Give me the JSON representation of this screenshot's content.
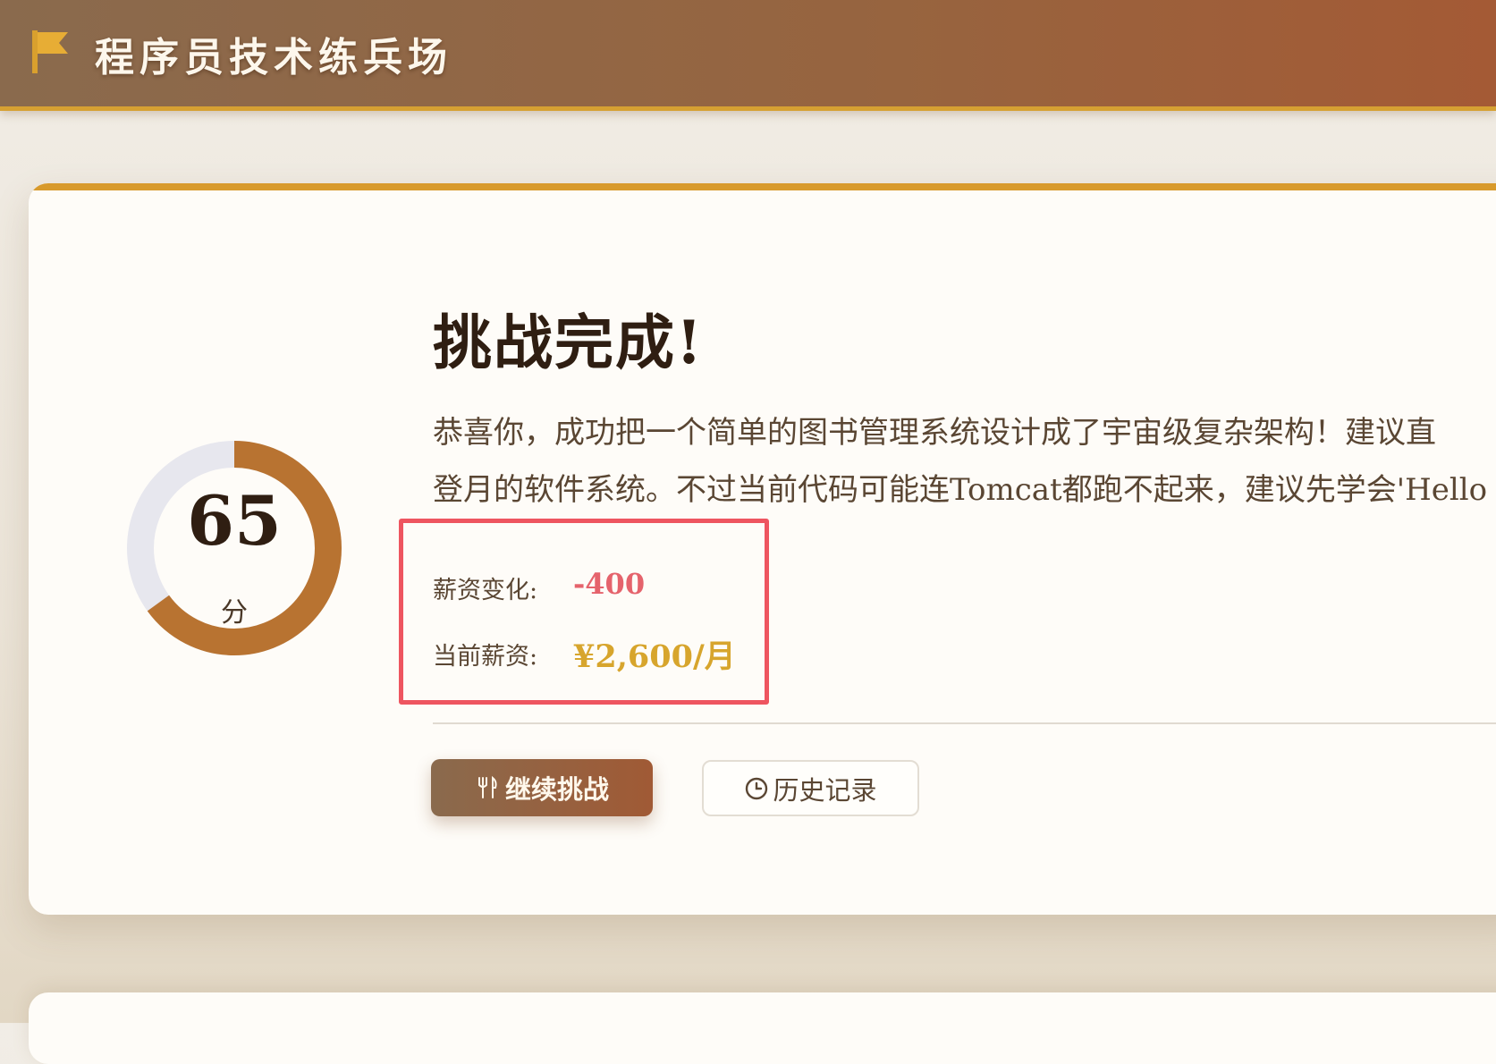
{
  "header": {
    "title": "程序员技术练兵场",
    "icon": "flag-icon"
  },
  "result": {
    "score": "65",
    "score_unit": "分",
    "score_percent": 65,
    "title": "挑战完成!",
    "description_line1": "恭喜你，成功把一个简单的图书管理系统设计成了宇宙级复杂架构！建议直",
    "description_line2": "登月的软件系统。不过当前代码可能连Tomcat都跑不起来，建议先学会'Hello"
  },
  "salary": {
    "change_label": "薪资变化:",
    "change_value": "-400",
    "current_label": "当前薪资:",
    "current_value": "¥2,600/月"
  },
  "actions": {
    "continue_label": "继续挑战",
    "continue_icon": "fork-knife-icon",
    "history_label": "历史记录",
    "history_icon": "clock-icon"
  },
  "colors": {
    "accent": "#d89a2c",
    "ring": "#b87331",
    "ring_track": "#e7e7ee",
    "negative": "#e5636c",
    "salary": "#d7a52d",
    "highlight_box": "#ee5560"
  }
}
